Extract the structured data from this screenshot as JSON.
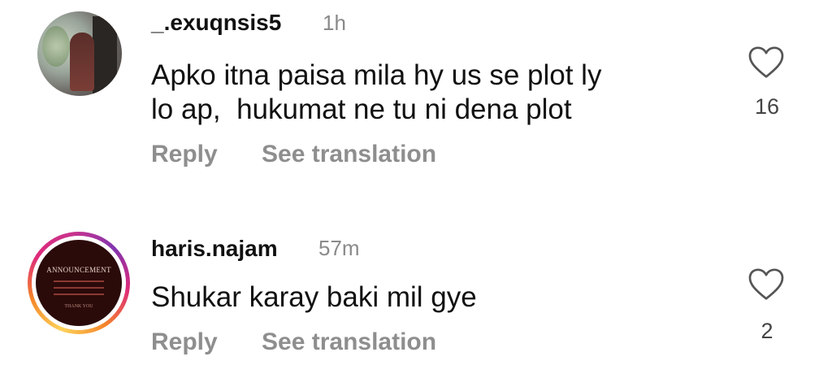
{
  "comments": [
    {
      "username": "_.exuqnsis5",
      "time": "1h",
      "text_line1": "Apko itna paisa mila hy us se plot ly",
      "text_line2": "lo ap,  hukumat ne tu ni dena plot",
      "reply_label": "Reply",
      "translate_label": "See translation",
      "likes": "16",
      "like_icon": "heart-outline"
    },
    {
      "username": "haris.najam",
      "time": "57m",
      "text_line1": "Shukar karay baki mil gye",
      "reply_label": "Reply",
      "translate_label": "See translation",
      "likes": "2",
      "like_icon": "heart-outline",
      "avatar_title": "ANNOUNCEMENT",
      "avatar_footer": "THANK YOU",
      "story_ring": true
    }
  ]
}
